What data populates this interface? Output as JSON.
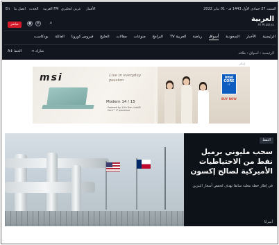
{
  "topbar": {
    "date": "السبت 27 جمادى الأول 1443 هـ - 01 يناير 2022",
    "links": [
      "اتصل بنا",
      "الحدث",
      "العربية FM",
      "عربي انجليزي",
      "الأقمار"
    ],
    "language_hint": "En"
  },
  "header": {
    "logo_ar": "العربية",
    "logo_en": "Al Arabiya",
    "live_label": "مباشر",
    "search_icon": "search-icon"
  },
  "nav": {
    "items": [
      "الرئيسية",
      "الأخبار",
      "السعودية",
      "أسواق",
      "رياضة",
      "العربية TV",
      "البرامج",
      "منوعات",
      "مقالات",
      "الخليج",
      "فيروس كورونا",
      "العائلة",
      "بودكاست"
    ],
    "active": "أسواق"
  },
  "breadcrumb": "الرئيسية › أسواق › طاقة",
  "toolbar": {
    "share_label": "شارك",
    "text_size_label": "الخط"
  },
  "ad": {
    "label": "إعلان",
    "brand": "msi",
    "slogan": "Live in everyday passion",
    "model": "Modern 14 / 15",
    "powered": "Powered by 11th Gen. Intel® Core™ i7 processor",
    "badge_title": "intel CORE",
    "badge_sub": "i7",
    "cta": "BUY NOW"
  },
  "article": {
    "tag": "النفط",
    "headline": "سحب مليوني برميل نفط من الاحتياطيات الأميركية لصالح إكسون",
    "summary": "في إطار خطة معلنة سابقا تهدف لخفض أسعار البنزين",
    "source": "أميركا"
  },
  "colors": {
    "background": "#12161f",
    "live": "#d51b2b",
    "accent": "#ffffff"
  }
}
